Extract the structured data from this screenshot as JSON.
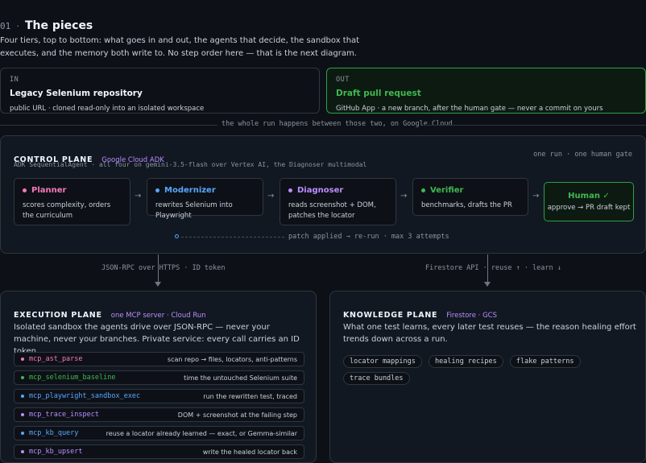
{
  "header": {
    "section_number": "01",
    "separator": "·",
    "title": "The pieces"
  },
  "lead": "Four tiers, top to bottom: what goes in and out, the agents that decide, the sandbox that executes, and the memory both write to. No step order here — that is the next diagram.",
  "input_card": {
    "tag": "IN",
    "title": "Legacy Selenium repository",
    "subtitle": "public URL · cloned read-only into an isolated workspace"
  },
  "output_card": {
    "tag": "OUT",
    "title": "Draft pull request",
    "subtitle": "GitHub App · a new branch, after the human gate — never a commit on yours"
  },
  "divider_text": "the whole run happens between those two, on Google Cloud",
  "control_plane": {
    "title": "CONTROL PLANE",
    "tag": "Google Cloud ADK",
    "right_note": "one run · one human gate",
    "subtitle": "ADK SequentialAgent · all four on gemini-3.5-flash over Vertex AI, the Diagnoser multimodal",
    "agents": [
      {
        "name": "Planner",
        "desc": "scores complexity, orders the curriculum",
        "color": "#f778ba"
      },
      {
        "name": "Modernizer",
        "desc": "rewrites Selenium into Playwright",
        "color": "#58a6ff"
      },
      {
        "name": "Diagnoser",
        "desc": "reads screenshot + DOM, patches the locator",
        "color": "#bc8cff"
      },
      {
        "name": "Verifier",
        "desc": "benchmarks, drafts the PR",
        "color": "#3fb950"
      }
    ],
    "arrow": "→",
    "human": {
      "title": "Human ✓",
      "desc": "approve → PR draft kept"
    },
    "loop_text": "patch applied → re-run · max 3 attempts"
  },
  "connectors": {
    "left": "JSON-RPC over HTTPS · ID token",
    "right": "Firestore API · reuse ↑ · learn ↓"
  },
  "execution_plane": {
    "title": "EXECUTION PLANE",
    "tag": "one MCP server · Cloud Run",
    "lead": "Isolated sandbox the agents drive over JSON-RPC — never your machine, never your branches. Private service: every call carries an ID token.",
    "tools": [
      {
        "name": "mcp_ast_parse",
        "desc": "scan repo → files, locators, anti-patterns",
        "color": "#f778ba"
      },
      {
        "name": "mcp_selenium_baseline",
        "desc": "time the untouched Selenium suite",
        "color": "#3fb950"
      },
      {
        "name": "mcp_playwright_sandbox_exec",
        "desc": "run the rewritten test, traced",
        "color": "#58a6ff"
      },
      {
        "name": "mcp_trace_inspect",
        "desc": "DOM + screenshot at the failing step",
        "color": "#bc8cff"
      },
      {
        "name": "mcp_kb_query",
        "desc": "reuse a locator already learned — exact, or Gemma-similar",
        "color": "#58a6ff"
      },
      {
        "name": "mcp_kb_upsert",
        "desc": "write the healed locator back",
        "color": "#bc8cff"
      }
    ]
  },
  "knowledge_plane": {
    "title": "KNOWLEDGE PLANE",
    "tag": "Firestore · GCS",
    "lead": "What one test learns, every later test reuses — the reason healing effort trends down across a run.",
    "chips": [
      "locator mappings",
      "healing recipes",
      "flake patterns",
      "trace bundles"
    ]
  }
}
